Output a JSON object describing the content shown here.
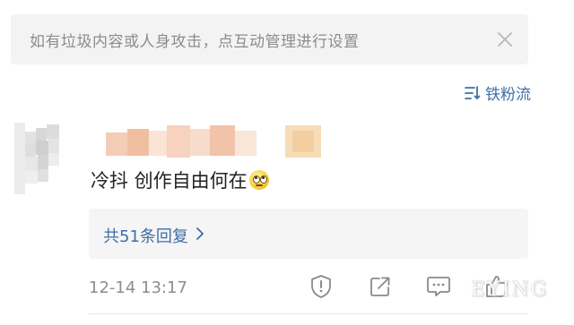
{
  "notice": {
    "text": "如有垃圾内容或人身攻击，点互动管理进行设置",
    "close_icon": "close-icon"
  },
  "filter": {
    "label": "铁粉流",
    "icon": "sort-list-icon",
    "color": "#3d6fa6"
  },
  "comment": {
    "text": "冷抖 创作自由何在",
    "emoji_icon": "rolling-eyes-emoji-icon"
  },
  "replies": {
    "label": "共51条回复",
    "icon": "chevron-right-icon"
  },
  "footer": {
    "timestamp": "12-14 13:17",
    "actions": [
      "report-icon",
      "share-icon",
      "comment-icon",
      "like-icon"
    ]
  },
  "watermark": {
    "text": "EYING"
  }
}
